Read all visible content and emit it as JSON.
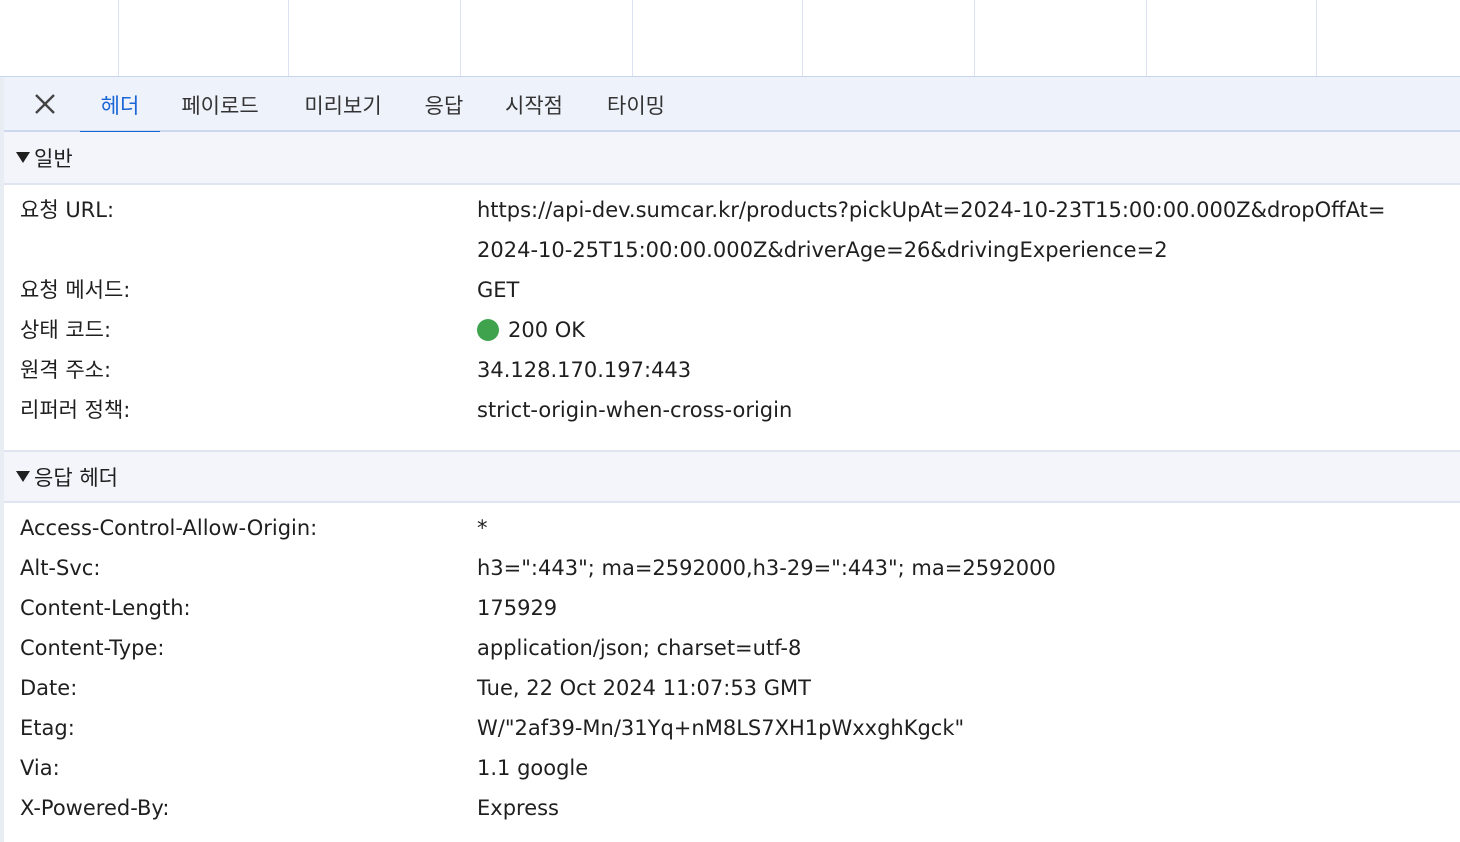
{
  "tabs": [
    {
      "label": "헤더",
      "active": true
    },
    {
      "label": "페이로드",
      "active": false
    },
    {
      "label": "미리보기",
      "active": false
    },
    {
      "label": "응답",
      "active": false
    },
    {
      "label": "시작점",
      "active": false
    },
    {
      "label": "타이밍",
      "active": false
    }
  ],
  "close_icon": "close-icon",
  "general": {
    "title": "일반",
    "rows": [
      {
        "key": "요청 URL:",
        "value_line1": "https://api-dev.sumcar.kr/products?pickUpAt=2024-10-23T15:00:00.000Z&dropOffAt=",
        "value_line2": "2024-10-25T15:00:00.000Z&driverAge=26&drivingExperience=2"
      },
      {
        "key": "요청 메서드:",
        "value": "GET"
      },
      {
        "key": "상태 코드:",
        "value": "200 OK"
      },
      {
        "key": "원격 주소:",
        "value": "34.128.170.197:443"
      },
      {
        "key": "리퍼러 정책:",
        "value": "strict-origin-when-cross-origin"
      }
    ]
  },
  "response_headers": {
    "title": "응답 헤더",
    "rows": [
      {
        "key": "Access-Control-Allow-Origin:",
        "value": "*"
      },
      {
        "key": "Alt-Svc:",
        "value": "h3=\":443\"; ma=2592000,h3-29=\":443\"; ma=2592000"
      },
      {
        "key": "Content-Length:",
        "value": "175929"
      },
      {
        "key": "Content-Type:",
        "value": "application/json; charset=utf-8"
      },
      {
        "key": "Date:",
        "value": "Tue, 22 Oct 2024 11:07:53 GMT"
      },
      {
        "key": "Etag:",
        "value": "W/\"2af39-Mn/31Yq+nM8LS7XH1pWxxghKgck\""
      },
      {
        "key": "Via:",
        "value": "1.1 google"
      },
      {
        "key": "X-Powered-By:",
        "value": "Express"
      }
    ]
  },
  "colors": {
    "accent": "#1a66d6",
    "status_ok": "#3fa34d",
    "tabbar_bg": "#eef2fb",
    "section_bg": "#f3f5fa"
  }
}
